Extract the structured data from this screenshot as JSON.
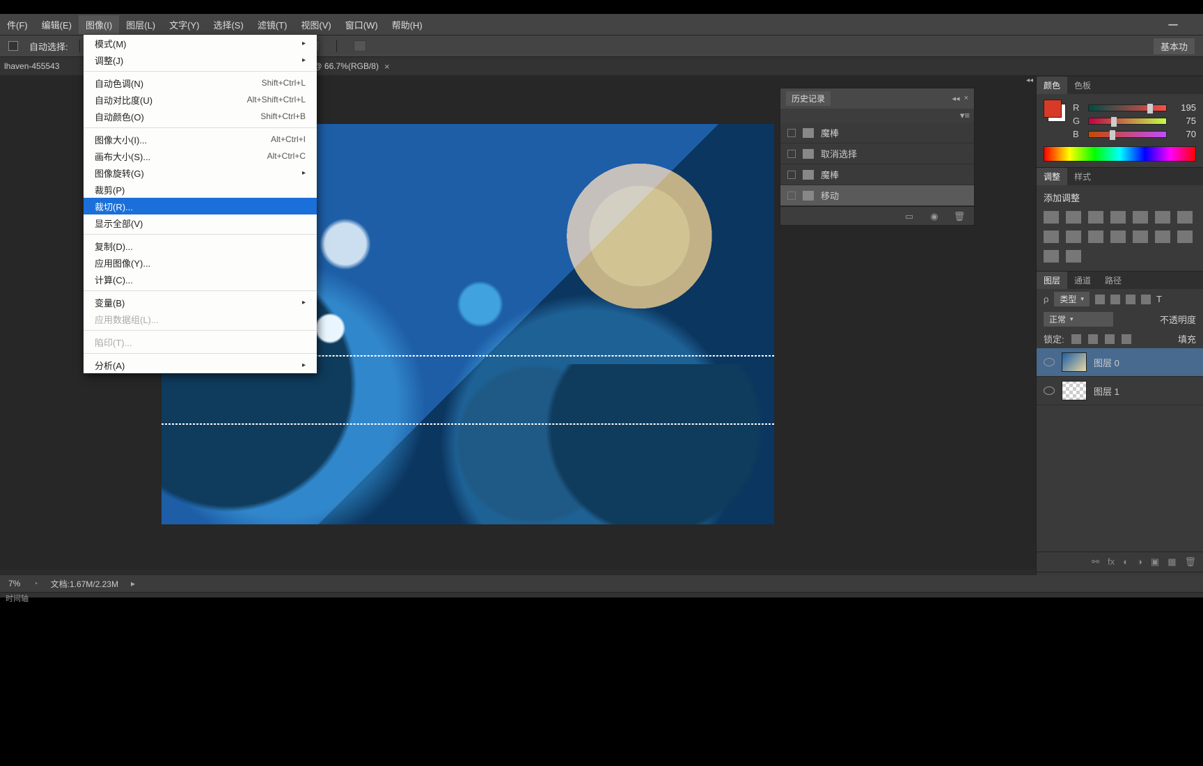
{
  "menubar": {
    "items": [
      "件(F)",
      "编辑(E)",
      "图像(I)",
      "图层(L)",
      "文字(Y)",
      "选择(S)",
      "滤镜(T)",
      "视图(V)",
      "窗口(W)",
      "帮助(H)"
    ],
    "active_index": 2
  },
  "options_bar": {
    "auto_select_label": "自动选择:",
    "right_button": "基本功"
  },
  "document_tab": {
    "left_fragment": "lhaven-455543",
    "title_fragment": "1 @ 66.7%(RGB/8)"
  },
  "dropdown": {
    "groups": [
      [
        {
          "label": "模式(M)",
          "shortcut": "",
          "arrow": true
        },
        {
          "label": "调整(J)",
          "shortcut": "",
          "arrow": true
        }
      ],
      [
        {
          "label": "自动色调(N)",
          "shortcut": "Shift+Ctrl+L"
        },
        {
          "label": "自动对比度(U)",
          "shortcut": "Alt+Shift+Ctrl+L"
        },
        {
          "label": "自动颜色(O)",
          "shortcut": "Shift+Ctrl+B"
        }
      ],
      [
        {
          "label": "图像大小(I)...",
          "shortcut": "Alt+Ctrl+I"
        },
        {
          "label": "画布大小(S)...",
          "shortcut": "Alt+Ctrl+C"
        },
        {
          "label": "图像旋转(G)",
          "shortcut": "",
          "arrow": true
        },
        {
          "label": "裁剪(P)",
          "shortcut": ""
        },
        {
          "label": "裁切(R)...",
          "shortcut": "",
          "highlight": true
        },
        {
          "label": "显示全部(V)",
          "shortcut": ""
        }
      ],
      [
        {
          "label": "复制(D)...",
          "shortcut": ""
        },
        {
          "label": "应用图像(Y)...",
          "shortcut": ""
        },
        {
          "label": "计算(C)...",
          "shortcut": ""
        }
      ],
      [
        {
          "label": "变量(B)",
          "shortcut": "",
          "arrow": true
        },
        {
          "label": "应用数据组(L)...",
          "shortcut": "",
          "disabled": true
        }
      ],
      [
        {
          "label": "陷印(T)...",
          "shortcut": "",
          "disabled": true
        }
      ],
      [
        {
          "label": "分析(A)",
          "shortcut": "",
          "arrow": true
        }
      ]
    ]
  },
  "history": {
    "title": "历史记录",
    "items": [
      {
        "label": "魔棒",
        "icon": "wand"
      },
      {
        "label": "取消选择",
        "icon": "deselect"
      },
      {
        "label": "魔棒",
        "icon": "wand"
      },
      {
        "label": "移动",
        "icon": "move",
        "current": true
      }
    ]
  },
  "color_panel": {
    "tabs": [
      "颜色",
      "色板"
    ],
    "active_tab": 0,
    "swatch_hex": "#d83a28",
    "channels": [
      {
        "label": "R",
        "value": 195,
        "grad": "linear-gradient(90deg,#004b46,#ff4b46)",
        "pos": 76
      },
      {
        "label": "G",
        "value": 75,
        "grad": "linear-gradient(90deg,#c30046,#c3ff46)",
        "pos": 29
      },
      {
        "label": "B",
        "value": 70,
        "grad": "linear-gradient(90deg,#c34b00,#c34bff)",
        "pos": 27
      }
    ]
  },
  "adjustments_panel": {
    "tabs": [
      "调整",
      "样式"
    ],
    "active_tab": 0,
    "title": "添加调整"
  },
  "layers_panel": {
    "tabs": [
      "图层",
      "通道",
      "路径"
    ],
    "active_tab": 0,
    "kind_label": "类型",
    "blend_mode": "正常",
    "opacity_label": "不透明度",
    "lock_label": "锁定:",
    "fill_label": "填充",
    "layers": [
      {
        "name": "图层 0",
        "selected": true,
        "thumb": "image"
      },
      {
        "name": "图层 1",
        "selected": false,
        "thumb": "trans"
      }
    ]
  },
  "status_bar": {
    "zoom": "7%",
    "doc_label": "文档:",
    "doc_size": "1.67M/2.23M",
    "timeline_fragment": "时间轴"
  }
}
